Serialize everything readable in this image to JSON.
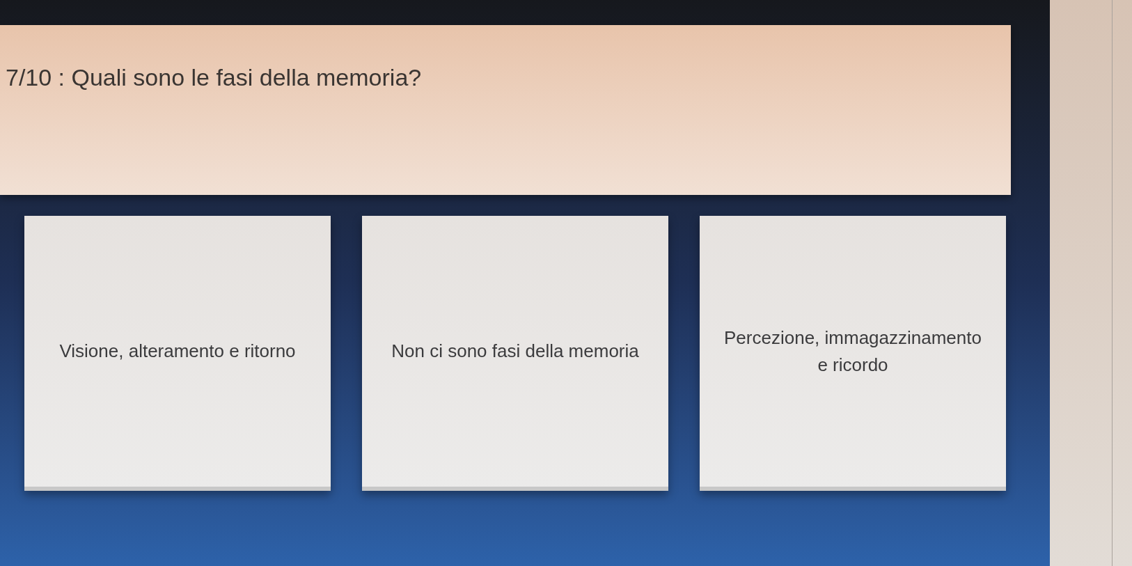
{
  "question": {
    "text": "7/10 : Quali sono le fasi della memoria?"
  },
  "answers": [
    {
      "text": "Visione, alteramento e ritorno"
    },
    {
      "text": "Non ci sono fasi della memoria"
    },
    {
      "text": "Percezione, immagazzinamento e ricordo"
    }
  ]
}
